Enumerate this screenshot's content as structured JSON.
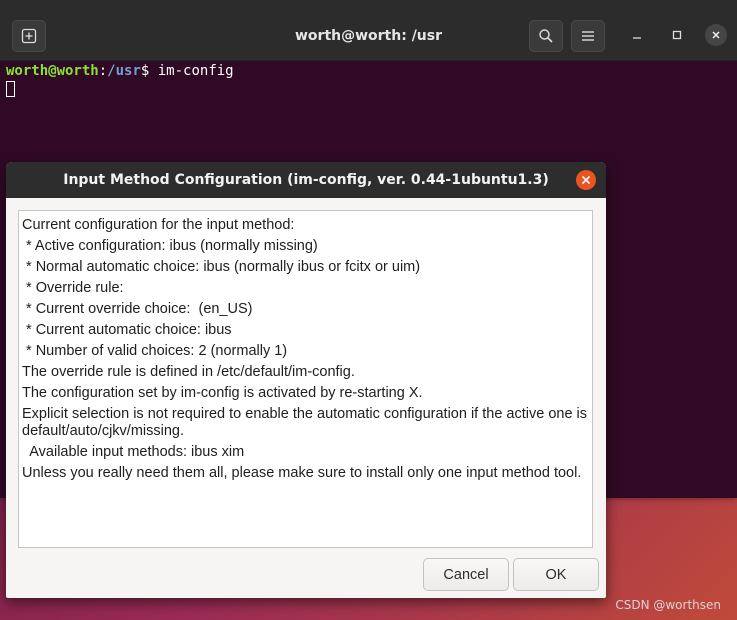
{
  "terminal": {
    "title": "worth@worth: /usr",
    "prompt_user": "worth@worth",
    "prompt_sep": ":",
    "prompt_path": "/usr",
    "prompt_symbol": "$",
    "command": " im-config",
    "icons": {
      "new_tab": "new-tab-icon",
      "search": "search-icon",
      "menu": "hamburger-menu-icon",
      "minimize": "minimize-icon",
      "maximize": "maximize-icon",
      "close": "close-icon"
    }
  },
  "dialog": {
    "title": "Input Method Configuration (im-config, ver. 0.44-1ubuntu1.3)",
    "lines": [
      "Current configuration for the input method:",
      " * Active configuration: ibus (normally missing)",
      " * Normal automatic choice: ibus (normally ibus or fcitx or uim)",
      " * Override rule:",
      " * Current override choice:  (en_US)",
      " * Current automatic choice: ibus",
      " * Number of valid choices: 2 (normally 1)",
      "The override rule is defined in /etc/default/im-config.",
      "The configuration set by im-config is activated by re-starting X.",
      "Explicit selection is not required to enable the automatic configuration if the active one is default/auto/cjkv/missing.",
      "  Available input methods: ibus xim",
      "Unless you really need them all, please make sure to install only one input method tool."
    ],
    "cancel_label": "Cancel",
    "ok_label": "OK",
    "close_icon": "close-icon"
  },
  "watermark": "CSDN @worthsen",
  "colors": {
    "terminal_bg": "#300a24",
    "header_bg": "#2c2c2c",
    "prompt_user": "#8ae234",
    "prompt_path": "#729fcf",
    "close_accent": "#e95420"
  }
}
